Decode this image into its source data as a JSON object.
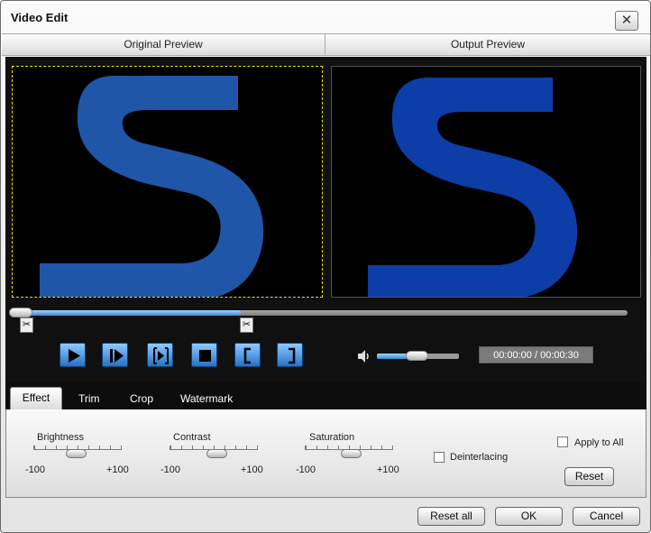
{
  "window": {
    "title": "Video Edit",
    "close_glyph": "✕"
  },
  "preview": {
    "original_label": "Original Preview",
    "output_label": "Output Preview"
  },
  "playback": {
    "progress_fraction": 0.37,
    "trim_marker_glyph": "✂",
    "buttons": [
      "play-icon",
      "play-step-icon",
      "frame-step-icon",
      "stop-icon",
      "mark-in-icon",
      "mark-out-icon"
    ],
    "volume_fraction": 0.5,
    "time": "00:00:00 / 00:00:30"
  },
  "tabs": [
    {
      "label": "Effect",
      "active": true
    },
    {
      "label": "Trim",
      "active": false
    },
    {
      "label": "Crop",
      "active": false
    },
    {
      "label": "Watermark",
      "active": false
    }
  ],
  "effect": {
    "brightness": {
      "label": "Brightness",
      "min": "-100",
      "max": "+100",
      "value": 0
    },
    "contrast": {
      "label": "Contrast",
      "min": "-100",
      "max": "+100",
      "value": 0
    },
    "saturation": {
      "label": "Saturation",
      "min": "-100",
      "max": "+100",
      "value": 0
    },
    "deinterlacing_label": "Deinterlacing",
    "deinterlacing_checked": false,
    "apply_to_all_label": "Apply to All",
    "apply_to_all_checked": false,
    "reset_label": "Reset"
  },
  "footer": {
    "reset_all_label": "Reset all",
    "ok_label": "OK",
    "cancel_label": "Cancel"
  },
  "colors": {
    "accent_blue": "#2473c6",
    "logo_blue_original": "#1f56a8",
    "logo_blue_output": "#0d3ea8"
  }
}
